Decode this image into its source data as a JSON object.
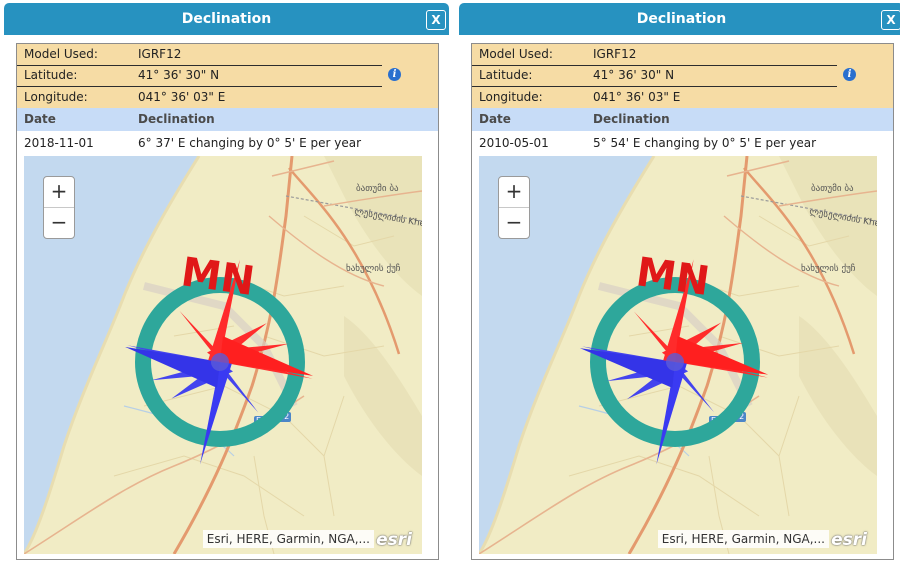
{
  "panels": [
    {
      "title": "Declination",
      "close_label": "X",
      "info": [
        {
          "key": "Model Used:",
          "value": "IGRF12"
        },
        {
          "key": "Latitude:",
          "value": "41° 36' 30\" N"
        },
        {
          "key": "Longitude:",
          "value": "041° 36' 03\" E"
        }
      ],
      "info_icon": "i",
      "table_headers": [
        "Date",
        "Declination"
      ],
      "row": {
        "date": "2018-11-01",
        "declination": "6° 37' E changing by  0° 5' E per year"
      },
      "zoom_in": "+",
      "zoom_out": "−",
      "compass_label": "MN",
      "declination_deg": 6.62,
      "map_labels": {
        "georgian_top": "ბათუმი ბა",
        "street1": "ლესელიძის Khelvacha",
        "street2": "ხახულის ქუჩ",
        "route1": "E70",
        "route2": "S2"
      },
      "attribution": "Esri, HERE, Garmin, NGA,...",
      "esri_logo": "esri"
    },
    {
      "title": "Declination",
      "close_label": "X",
      "info": [
        {
          "key": "Model Used:",
          "value": "IGRF12"
        },
        {
          "key": "Latitude:",
          "value": "41° 36' 30\" N"
        },
        {
          "key": "Longitude:",
          "value": "041° 36' 03\" E"
        }
      ],
      "info_icon": "i",
      "table_headers": [
        "Date",
        "Declination"
      ],
      "row": {
        "date": "2010-05-01",
        "declination": "5° 54' E changing by  0° 5' E per year"
      },
      "zoom_in": "+",
      "zoom_out": "−",
      "compass_label": "MN",
      "declination_deg": 5.9,
      "map_labels": {
        "georgian_top": "ბათუმი ბა",
        "street1": "ლესელიძის Khelvacha",
        "street2": "ხახულის ქუჩ",
        "route1": "E70",
        "route2": "S2"
      },
      "attribution": "Esri, HERE, Garmin, NGA,...",
      "esri_logo": "esri"
    }
  ],
  "colors": {
    "titlebar": "#2792c0",
    "info_bg": "#f6dca5",
    "header_bg": "#c7dcf7",
    "ring": "#2ea79b",
    "needle_red": "#ff1f1f",
    "needle_blue": "#3d3df0",
    "land": "#f1ecc5",
    "water": "#c3d9ef",
    "road": "#e49a6e"
  }
}
